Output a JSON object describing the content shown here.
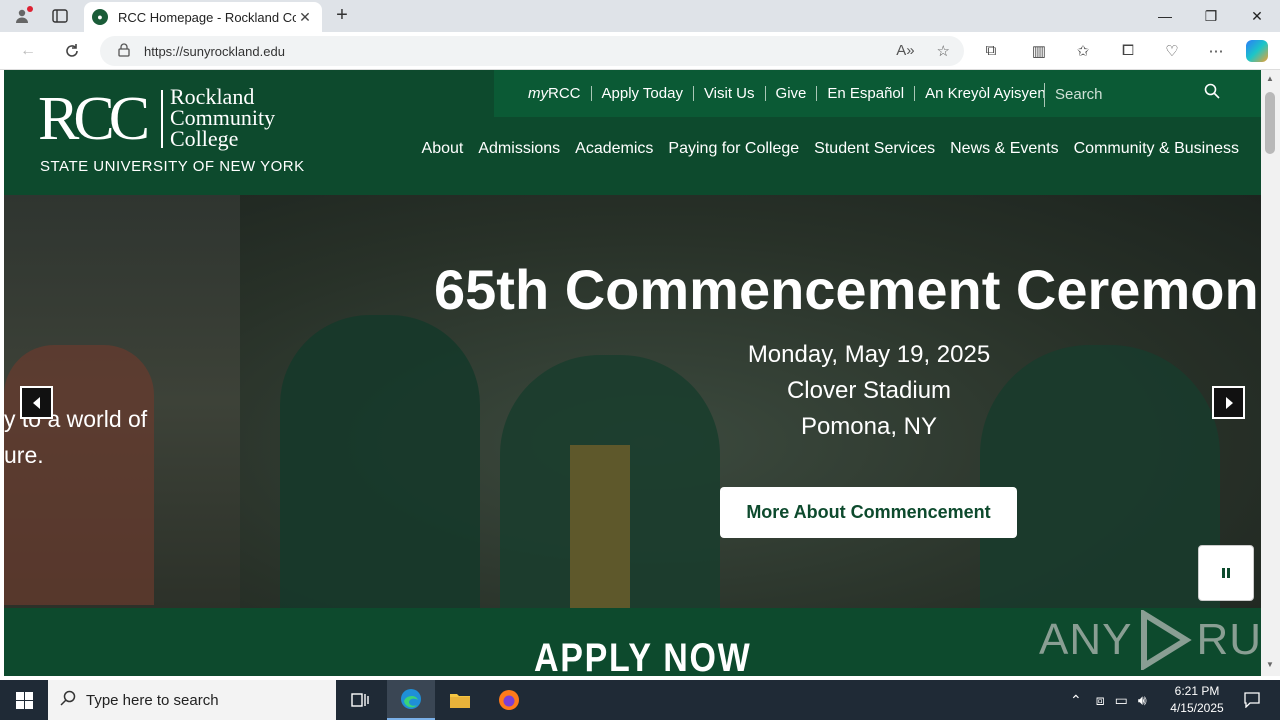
{
  "browser": {
    "tab_title": "RCC Homepage - Rockland Com",
    "tab_close": "✕",
    "new_tab": "+",
    "url": "https://sunyrockland.edu",
    "minimize": "—",
    "maximize": "❐",
    "close": "✕"
  },
  "site": {
    "logo": {
      "rcc": "RCC",
      "name_line1": "Rockland",
      "name_line2": "Community",
      "name_line3": "College",
      "suny": "STATE UNIVERSITY OF NEW YORK"
    },
    "utility_nav": {
      "my": "my",
      "my_rcc": "RCC",
      "apply": "Apply Today",
      "visit": "Visit Us",
      "give": "Give",
      "espanol": "En Español",
      "kreyol": "An Kreyòl Ayisyen",
      "search_placeholder": "Search"
    },
    "main_nav": [
      "About",
      "Admissions",
      "Academics",
      "Paying for College",
      "Student Services",
      "News & Events",
      "Community & Business"
    ],
    "hero": {
      "left_line1": "y to a world of",
      "left_line2": "ure.",
      "title": "65th Commencement Ceremon",
      "date": "Monday, May 19, 2025",
      "venue": "Clover Stadium",
      "location": "Pomona, NY",
      "button": "More About Commencement"
    },
    "apply_now": "APPLY NOW",
    "watermark_left": "ANY",
    "watermark_right": "RUN"
  },
  "taskbar": {
    "search_placeholder": "Type here to search",
    "time": "6:21 PM",
    "date": "4/15/2025"
  }
}
